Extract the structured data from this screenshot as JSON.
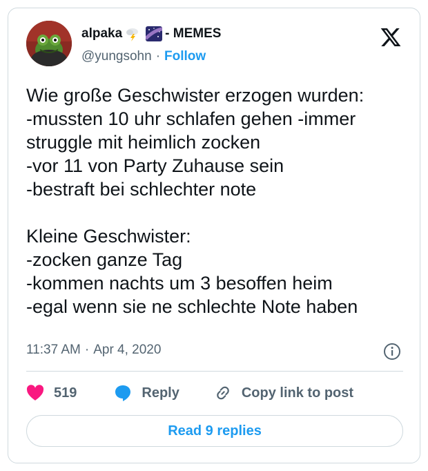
{
  "author": {
    "display_name": "alpaka",
    "name_suffix": "- MEMES",
    "handle": "@yungsohn",
    "follow_label": "Follow",
    "emoji": [
      "cloud-lightning-icon",
      "milky-way-icon"
    ]
  },
  "tweet": {
    "text": "Wie große Geschwister erzogen wurden:\n-mussten 10 uhr schlafen gehen -immer struggle mit heimlich zocken\n-vor 11 von Party Zuhause sein\n-bestraft bei schlechter note\n\nKleine Geschwister:\n-zocken ganze Tag\n-kommen nachts um 3 besoffen heim\n-egal wenn sie ne schlechte Note haben",
    "time": "11:37 AM",
    "separator": "·",
    "date": "Apr 4, 2020"
  },
  "actions": {
    "like_count": "519",
    "reply_label": "Reply",
    "copy_label": "Copy link to post"
  },
  "read_replies_label": "Read 9 replies",
  "colors": {
    "like": "#f91880",
    "reply": "#1d9bf0",
    "link": "#1d9bf0",
    "secondary_text": "#536471",
    "border": "#cfd9de"
  }
}
